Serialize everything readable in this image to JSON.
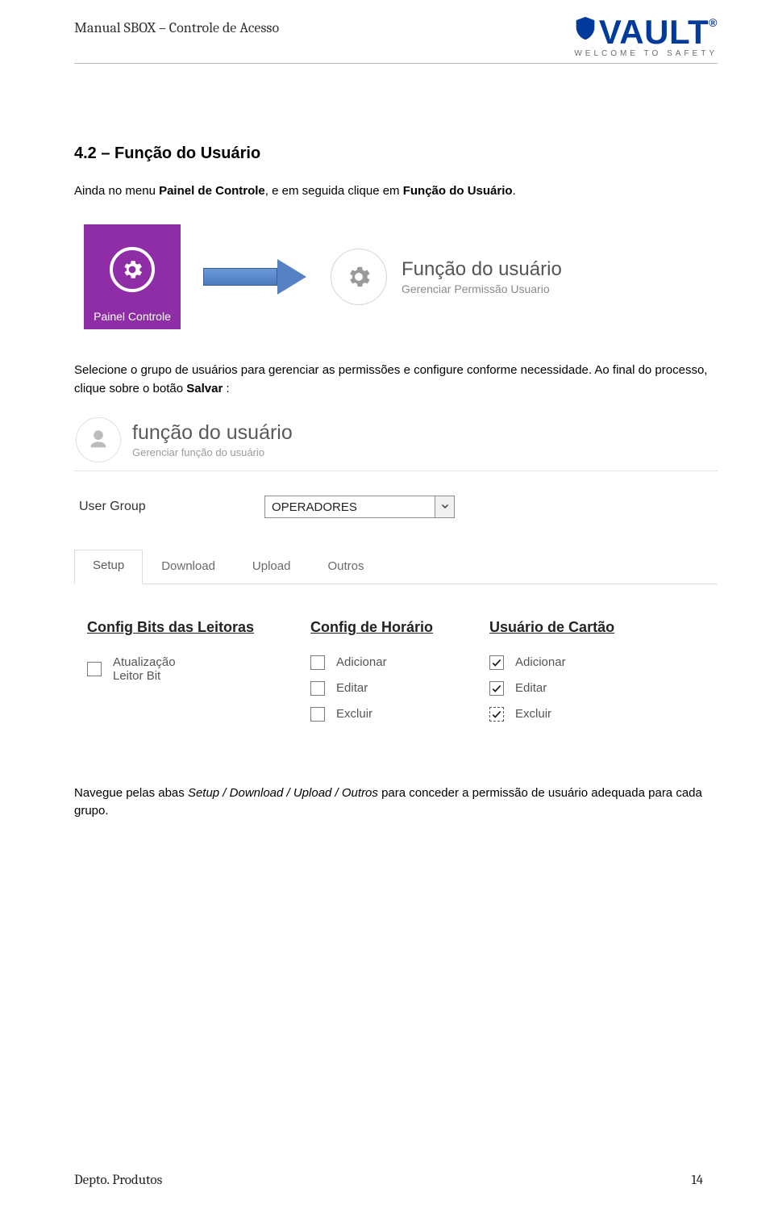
{
  "header": {
    "doc_title": "Manual SBOX – Controle de Acesso",
    "logo_text": "VAULT",
    "logo_tagline": "WELCOME TO SAFETY"
  },
  "section": {
    "heading": "4.2 – Função do Usuário",
    "para1_pre": "Ainda no menu ",
    "para1_bold1": "Painel de Controle",
    "para1_mid": ", e em seguida clique em ",
    "para1_bold2": "Função do Usuário",
    "para1_post": ".",
    "para2_pre": "Selecione o grupo de usuários para gerenciar as permissões e configure conforme necessidade. Ao final do processo, clique sobre o botão ",
    "para2_bold": "Salvar",
    "para2_post": " :",
    "para3_pre": "Navegue pelas abas ",
    "para3_ital": "Setup / Download / Upload / Outros",
    "para3_post": " para conceder a permissão de usuário adequada para cada grupo."
  },
  "fig1": {
    "tile_label": "Painel Controle",
    "card_title": "Função do usuário",
    "card_sub": "Gerenciar Permissão Usuario"
  },
  "panel": {
    "head_title": "função do usuário",
    "head_sub": "Gerenciar função do usuário",
    "usergroup_label": "User Group",
    "usergroup_value": "OPERADORES",
    "tabs": {
      "setup": "Setup",
      "download": "Download",
      "upload": "Upload",
      "outros": "Outros"
    },
    "cols": {
      "c1_title": "Config Bits das Leitoras",
      "c1_opt1": "Atualização Leitor Bit",
      "c2_title": "Config de Horário",
      "c2_opt1": "Adicionar",
      "c2_opt2": "Editar",
      "c2_opt3": "Excluir",
      "c3_title": "Usuário de Cartão",
      "c3_opt1": "Adicionar",
      "c3_opt2": "Editar",
      "c3_opt3": "Excluir"
    }
  },
  "footer": {
    "dept": "Depto. Produtos",
    "page": "14"
  }
}
